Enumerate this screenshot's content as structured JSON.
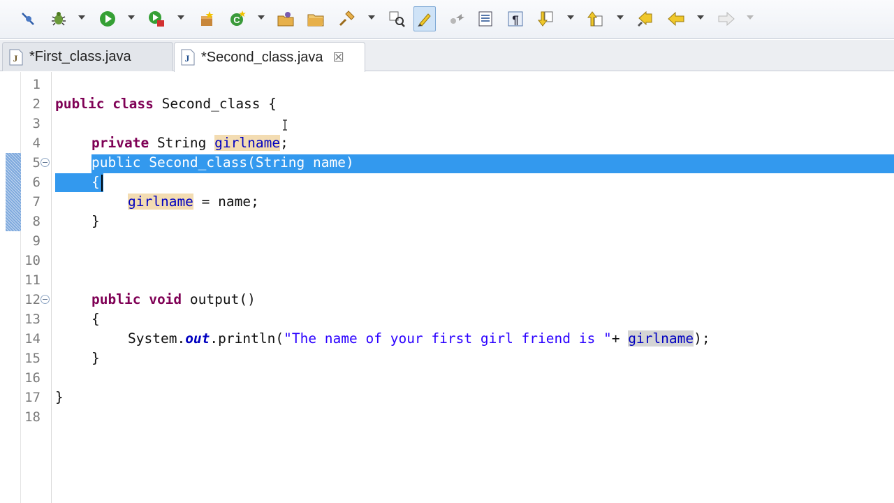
{
  "toolbar": {
    "buttons": [
      {
        "name": "skip-breakpoints-icon",
        "dropdown": false
      },
      {
        "name": "debug-icon",
        "dropdown": true
      },
      {
        "name": "run-icon",
        "dropdown": true
      },
      {
        "name": "run-coverage-icon",
        "dropdown": true
      },
      {
        "name": "new-java-package-icon",
        "dropdown": false
      },
      {
        "name": "new-java-class-icon",
        "dropdown": true
      },
      {
        "name": "open-type-icon",
        "dropdown": false
      },
      {
        "name": "open-folder-icon",
        "dropdown": false
      },
      {
        "name": "search-icon",
        "dropdown": true
      },
      {
        "name": "open-task-icon",
        "dropdown": false
      },
      {
        "name": "mark-occurrences-icon",
        "dropdown": false,
        "active": true
      },
      {
        "name": "block-selection-icon",
        "dropdown": false
      },
      {
        "name": "show-source-icon",
        "dropdown": false
      },
      {
        "name": "show-whitespace-icon",
        "dropdown": false
      },
      {
        "name": "next-annotation-icon",
        "dropdown": true
      },
      {
        "name": "previous-annotation-icon",
        "dropdown": true
      },
      {
        "name": "last-edit-location-icon",
        "dropdown": false
      },
      {
        "name": "back-icon",
        "dropdown": true
      },
      {
        "name": "forward-icon",
        "dropdown": true
      }
    ]
  },
  "tabs": [
    {
      "label": "*First_class.java",
      "active": false
    },
    {
      "label": "*Second_class.java",
      "active": true,
      "close_glyph": "☒"
    }
  ],
  "editor": {
    "line_numbers": [
      "1",
      "2",
      "3",
      "4",
      "5",
      "6",
      "7",
      "8",
      "9",
      "10",
      "11",
      "12",
      "13",
      "14",
      "15",
      "16",
      "17",
      "18"
    ],
    "lines": {
      "l2": {
        "kw1": "public",
        "kw2": "class",
        "name": "Second_class",
        "brace": "{"
      },
      "l4": {
        "kw": "private",
        "type": "String",
        "field": "girlname",
        "end": ";"
      },
      "l5": {
        "kw": "public",
        "rest": "Second_class(String name)"
      },
      "l6": {
        "brace": "{"
      },
      "l7": {
        "field": "girlname",
        "rest": " = name;"
      },
      "l8": {
        "brace": "}"
      },
      "l12": {
        "kw1": "public",
        "kw2": "void",
        "rest": "output()"
      },
      "l13": {
        "brace": "{"
      },
      "l14": {
        "obj": "System.",
        "sfield": "out",
        "call": ".println(",
        "string": "\"The name of your first girl friend is \"",
        "plus": "+ ",
        "field": "girlname",
        "end": ");"
      },
      "l15": {
        "brace": "}"
      },
      "l17": {
        "brace": "}"
      }
    },
    "selection_color": "#3399ee",
    "keyword_color": "#7f0055",
    "field_color": "#0000c0",
    "string_color": "#2a00ff"
  }
}
